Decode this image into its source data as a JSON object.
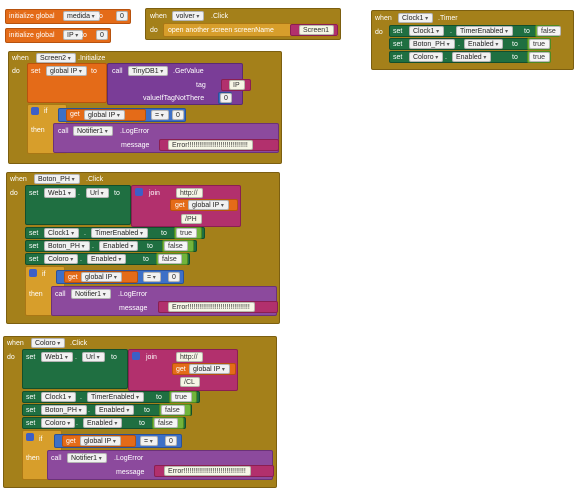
{
  "colors": {
    "event": "#a4801a",
    "variable": "#e46b18",
    "component": "#1f6f41",
    "tinydb": "#7a3d97",
    "notifier": "#8c4a9d",
    "text": "#b2306d",
    "math": "#3d70c7",
    "control": "#d79e2b",
    "logic": "#71b43c"
  },
  "globals": [
    {
      "keyword": "initialize global",
      "name": "medida",
      "to": "to",
      "value": "0"
    },
    {
      "keyword": "initialize global",
      "name": "IP",
      "to": "to",
      "value": "0"
    }
  ],
  "volver": {
    "when": "when",
    "component": "volver",
    "event": ".Click",
    "do": "do",
    "action": "open another screen  screenName",
    "screen": "Screen1"
  },
  "clock": {
    "when": "when",
    "component": "Clock1",
    "event": ".Timer",
    "do": "do",
    "rows": [
      {
        "set": "set",
        "component": "Clock1",
        "dot": ".",
        "prop": "TimerEnabled",
        "to": "to",
        "value": "false"
      },
      {
        "set": "set",
        "component": "Boton_PH",
        "dot": ".",
        "prop": "Enabled",
        "to": "to",
        "value": "true"
      },
      {
        "set": "set",
        "component": "Coloro",
        "dot": ".",
        "prop": "Enabled",
        "to": "to",
        "value": "true"
      }
    ]
  },
  "screen2": {
    "when": "when",
    "component": "Screen2",
    "event": ".Initialize",
    "do": "do",
    "set": "set",
    "var": "global IP",
    "to": "to",
    "call": "call",
    "db": "TinyDB1",
    "method": ".GetValue",
    "tag_label": "tag",
    "tag_value": "IP",
    "ifnot_label": "valueIfTagNotThere",
    "ifnot_value": "0",
    "if": "if",
    "get": "get",
    "get_var": "global IP",
    "op": "=",
    "cmp": "0",
    "then": "then",
    "notifier": "Notifier1",
    "notif_method": ".LogError",
    "message": "message",
    "msg_value": "Error!!!!!!!!!!!!!!!!!!!!!!!!!!!!!!!"
  },
  "botonph": {
    "when": "when",
    "component": "Boton_PH",
    "event": ".Click",
    "do": "do",
    "set": "set",
    "web": "Web1",
    "dot": ".",
    "url": "Url",
    "to": "to",
    "join": "join",
    "parts": [
      "http://",
      "global IP",
      "/PH"
    ],
    "get": "get",
    "rows": [
      {
        "set": "set",
        "component": "Clock1",
        "dot": ".",
        "prop": "TimerEnabled",
        "to": "to",
        "value": "true"
      },
      {
        "set": "set",
        "component": "Boton_PH",
        "dot": ".",
        "prop": "Enabled",
        "to": "to",
        "value": "false"
      },
      {
        "set": "set",
        "component": "Coloro",
        "dot": ".",
        "prop": "Enabled",
        "to": "to",
        "value": "false"
      }
    ],
    "if": "if",
    "get_var": "global IP",
    "op": "=",
    "cmp": "0",
    "then": "then",
    "call": "call",
    "notifier": "Notifier1",
    "notif_method": ".LogError",
    "message": "message",
    "msg_value": "Error!!!!!!!!!!!!!!!!!!!!!!!!!!!!!!!!"
  },
  "coloro": {
    "when": "when",
    "component": "Coloro",
    "event": ".Click",
    "do": "do",
    "set": "set",
    "web": "Web1",
    "dot": ".",
    "url": "Url",
    "to": "to",
    "join": "join",
    "parts": [
      "http://",
      "global IP",
      "/CL"
    ],
    "get": "get",
    "rows": [
      {
        "set": "set",
        "component": "Clock1",
        "dot": ".",
        "prop": "TimerEnabled",
        "to": "to",
        "value": "true"
      },
      {
        "set": "set",
        "component": "Boton_PH",
        "dot": ".",
        "prop": "Enabled",
        "to": "to",
        "value": "false"
      },
      {
        "set": "set",
        "component": "Coloro",
        "dot": ".",
        "prop": "Enabled",
        "to": "to",
        "value": "false"
      }
    ],
    "if": "if",
    "get_var": "global IP",
    "op": "=",
    "cmp": "0",
    "then": "then",
    "call": "call",
    "notifier": "Notifier1",
    "notif_method": ".LogError",
    "message": "message",
    "msg_value": "Error!!!!!!!!!!!!!!!!!!!!!!!!!!!!!!!!"
  }
}
